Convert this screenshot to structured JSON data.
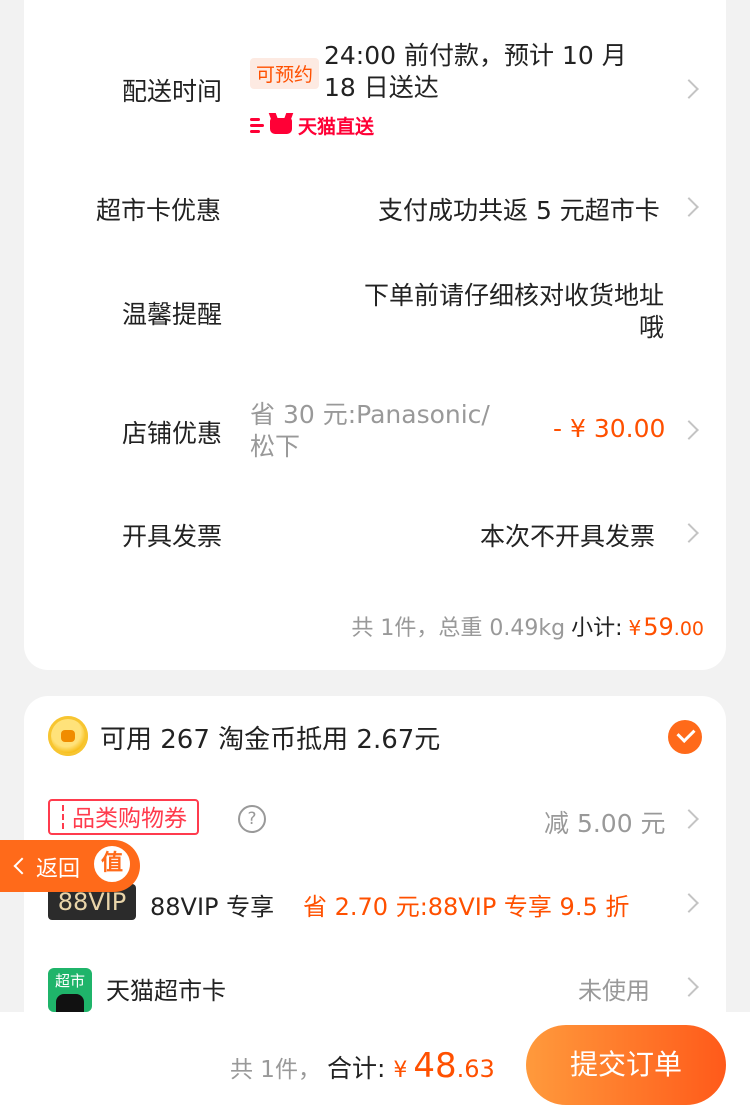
{
  "delivery": {
    "label": "配送时间",
    "badge": "可预约",
    "text": "24:00 前付款，预计 10 月 18 日送达",
    "tag": "天猫直送"
  },
  "supermarket_card_offer": {
    "label": "超市卡优惠",
    "value": "支付成功共返 5 元超市卡"
  },
  "reminder": {
    "label": "温馨提醒",
    "value": "下单前请仔细核对收货地址哦"
  },
  "store_discount": {
    "label": "店铺优惠",
    "desc": "省 30 元:Panasonic/松下",
    "amount": "- ¥ 30.00"
  },
  "invoice": {
    "label": "开具发票",
    "value": "本次不开具发票"
  },
  "subtotal": {
    "summary": "共 1件，总重 0.49kg",
    "label": "小计:",
    "currency": "¥",
    "int": "59",
    "dec": ".00"
  },
  "coins": {
    "text": "可用 267 淘金币抵用 2.67元",
    "checked": true
  },
  "category_coupon": {
    "tag": "品类购物券",
    "help": "?",
    "value": "减 5.00 元"
  },
  "floating_back": {
    "label": "返回",
    "circle": "值"
  },
  "vip": {
    "badge": "88VIP",
    "label": "88VIP 专享",
    "value": "省 2.70 元:88VIP 专享 9.5 折"
  },
  "tmall_card": {
    "icon_text": "超市",
    "label": "天猫超市卡",
    "value": "未使用"
  },
  "footer": {
    "count": "共 1件，",
    "total_label": "合计:",
    "currency": "¥",
    "int": "48",
    "dec": ".63",
    "submit": "提交订单"
  },
  "colors": {
    "accent": "#ff5000",
    "submit_gradient_start": "#ff9a3c",
    "submit_gradient_end": "#ff5a1a",
    "tmall_red": "#ff0036"
  },
  "icons": [
    "chevron-right-icon",
    "coin-icon",
    "check-icon",
    "help-icon",
    "chevron-left-icon",
    "tmall-cat-icon"
  ]
}
